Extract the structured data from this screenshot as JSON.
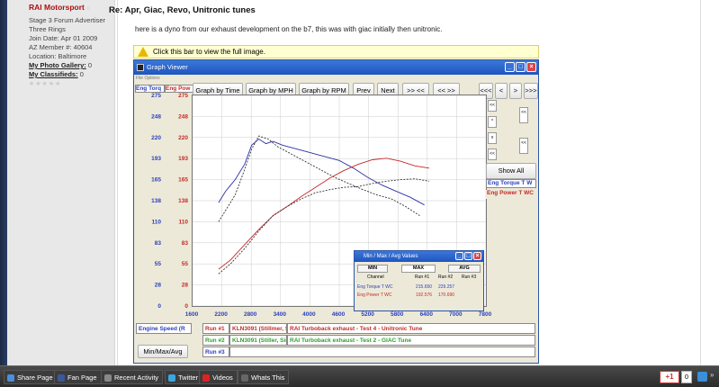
{
  "user": {
    "name": "RAI Motorsport",
    "status_dot": "○",
    "title_line1": "Stage 3 Forum Advertiser",
    "title_line2": "Three Rings",
    "join_date": "Join Date:   Apr 01 2009",
    "az_member": "AZ Member #:   40604",
    "location": "Location:    Baltimore",
    "photo_gallery_label": "My Photo Gallery:",
    "photo_gallery_count": "0",
    "classifieds_label": "My Classifieds:",
    "classifieds_count": "0",
    "stars": "★★★★★"
  },
  "post": {
    "title": "Re: Apr, Giac, Revo, Unitronic tunes",
    "body": "here is a dyno from our exhaust development on the b7, this was with giac initially then unitronic.",
    "notice": "Click this bar to view the full image."
  },
  "graph_viewer": {
    "title": "Graph Viewer",
    "menu": "File  Options",
    "buttons": {
      "by_time": "Graph by Time",
      "by_mph": "Graph by MPH",
      "by_rpm": "Graph by RPM",
      "prev": "Prev",
      "next": "Next",
      "right_left": ">> <<",
      "left_right": "<< >>",
      "first": "<<<",
      "back": "<",
      "forward": ">",
      "last": ">>>",
      "show_all": "Show All",
      "minmaxavg": "Min/Max/Avg"
    },
    "minibtn_glyphs": [
      "<<",
      "^",
      "v",
      "<<",
      "<<",
      "<<"
    ],
    "left_axis_header": "Eng Torq",
    "right_axis_header": "Eng Pow",
    "side_label_torque": "Eng Torque T W",
    "side_label_power": "Eng Power T WC",
    "bottom": {
      "engine_speed": "Engine Speed (R",
      "run1_label": "Run #1",
      "run1_file": "KLN3091 (Stillmer, Sir",
      "run1_desc": "RAI Turboback exhaust - Test 4 - Unitronic Tune",
      "run2_label": "Run #2",
      "run2_file": "KLN3091 (Stiller, Sir",
      "run2_desc": "RAI Turboback exhaust - Test 2 - GIAC Tune",
      "run3_label": "Run #3"
    }
  },
  "minmax": {
    "title": "Min / Max / Avg Values",
    "min": "MIN",
    "max": "MAX",
    "avg": "AVG",
    "channel": "Channel",
    "run1": "Run #1",
    "run2": "Run #2",
    "run3": "Run #3",
    "torque_label": "Eng Torque T WC",
    "torque_r1": "215.650",
    "torque_r2": "229.257",
    "power_label": "Eng Power T WC",
    "power_r1": "192.576",
    "power_r2": "170.690"
  },
  "taskbar": {
    "share": "Share Page",
    "fan": "Fan Page",
    "activity": "Recent Activity",
    "twitter": "Twitter",
    "videos": "Videos",
    "whats": "Whats This",
    "gplus": "+1",
    "count": "0"
  },
  "colors": {
    "torque_axis": "#2a3fbf",
    "power_axis": "#c62828",
    "run2_text": "#2e9e2e",
    "torque_run1": "#2b2fa6",
    "power_run1": "#c62828",
    "run2_dashed": "#333333"
  },
  "chart_data": {
    "type": "line",
    "x_ticks": [
      "1600",
      "2200",
      "2800",
      "3400",
      "4000",
      "4600",
      "5200",
      "5800",
      "6400",
      "7000",
      "7800"
    ],
    "xlim": [
      1600,
      7800
    ],
    "y_ticks_left": [
      "275",
      "248",
      "220",
      "193",
      "165",
      "138",
      "110",
      "83",
      "55",
      "28",
      "0"
    ],
    "y_ticks_right": [
      "275",
      "248",
      "220",
      "193",
      "165",
      "138",
      "110",
      "83",
      "55",
      "28",
      "0"
    ],
    "ylim": [
      0,
      275
    ],
    "series": [
      {
        "name": "Run #1 Eng Torque",
        "style": "solid",
        "color": "#2b2fa6",
        "x": [
          2150,
          2300,
          2500,
          2700,
          2850,
          3000,
          3150,
          3300,
          3500,
          3800,
          4100,
          4400,
          4700,
          5000,
          5300,
          5600,
          5900,
          6200,
          6500
        ],
        "y": [
          135,
          150,
          165,
          185,
          210,
          218,
          212,
          215,
          210,
          205,
          200,
          195,
          190,
          180,
          168,
          158,
          150,
          142,
          132
        ]
      },
      {
        "name": "Run #2 Eng Torque",
        "style": "dashed",
        "color": "#333333",
        "x": [
          2150,
          2300,
          2500,
          2700,
          2850,
          3000,
          3200,
          3400,
          3700,
          4000,
          4300,
          4600,
          4900,
          5200,
          5500,
          5800,
          6100,
          6400
        ],
        "y": [
          110,
          125,
          145,
          178,
          205,
          222,
          218,
          208,
          198,
          188,
          178,
          168,
          160,
          152,
          145,
          140,
          130,
          118
        ]
      },
      {
        "name": "Run #1 Eng Power",
        "style": "solid",
        "color": "#c62828",
        "x": [
          2150,
          2400,
          2700,
          3000,
          3300,
          3600,
          3900,
          4200,
          4500,
          4800,
          5100,
          5400,
          5700,
          6000,
          6300,
          6600
        ],
        "y": [
          48,
          60,
          80,
          100,
          118,
          130,
          143,
          155,
          167,
          177,
          185,
          191,
          193,
          189,
          183,
          180
        ]
      },
      {
        "name": "Run #2 Eng Power",
        "style": "dashed",
        "color": "#333333",
        "x": [
          2150,
          2400,
          2700,
          3000,
          3300,
          3600,
          3900,
          4200,
          4500,
          4800,
          5100,
          5400,
          5700,
          6000,
          6300,
          6600
        ],
        "y": [
          42,
          55,
          75,
          98,
          118,
          130,
          140,
          148,
          152,
          155,
          156,
          160,
          163,
          165,
          166,
          163
        ]
      }
    ]
  }
}
